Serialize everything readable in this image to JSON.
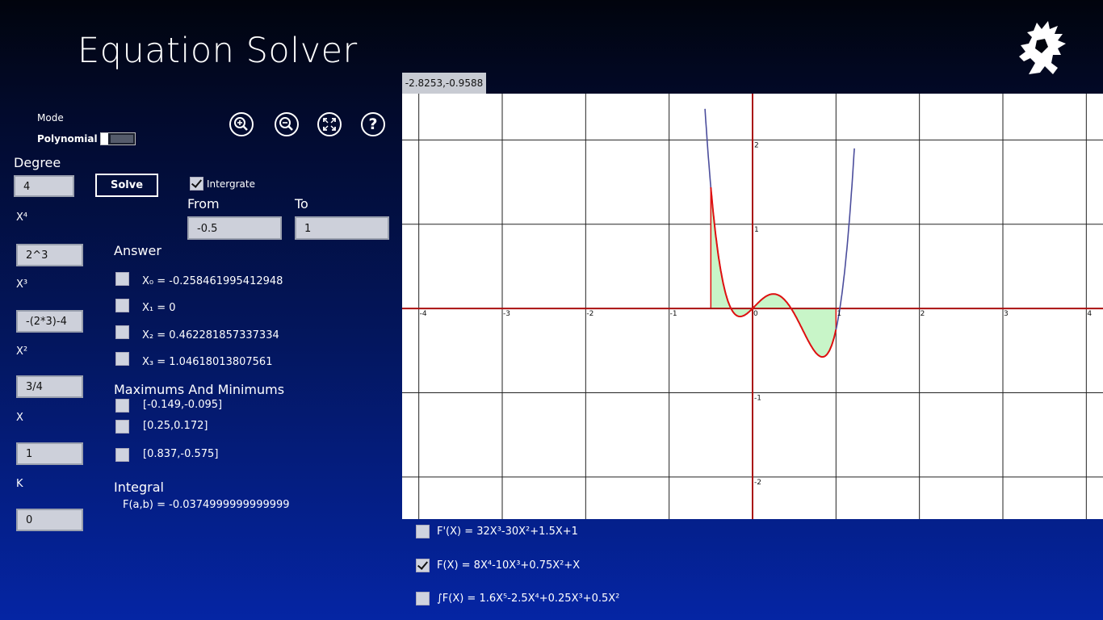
{
  "app": {
    "title": "Equation Solver"
  },
  "mode": {
    "label": "Mode",
    "value": "Polynomial"
  },
  "degree": {
    "label": "Degree",
    "value": "4",
    "solve_label": "Solve"
  },
  "integrate": {
    "label": "Intergrate",
    "checked": true,
    "from_label": "From",
    "from_value": "-0.5",
    "to_label": "To",
    "to_value": "1"
  },
  "coefficients": [
    {
      "label": "X⁴",
      "value": "2^3"
    },
    {
      "label": "X³",
      "value": "-(2*3)-4"
    },
    {
      "label": "X²",
      "value": "3/4"
    },
    {
      "label": "X",
      "value": "1"
    },
    {
      "label": "K",
      "value": "0"
    }
  ],
  "answer": {
    "heading": "Answer",
    "roots": [
      {
        "label": "X₀ = -0.258461995412948",
        "checked": false
      },
      {
        "label": "X₁ = 0",
        "checked": false
      },
      {
        "label": "X₂ = 0.462281857337334",
        "checked": false
      },
      {
        "label": "X₃ = 1.04618013807561",
        "checked": false
      }
    ]
  },
  "extrema": {
    "heading": "Maximums And Minimums",
    "items": [
      {
        "label": "[-0.149,-0.095]",
        "checked": false
      },
      {
        "label": "[0.25,0.172]",
        "checked": false
      },
      {
        "label": "[0.837,-0.575]",
        "checked": false
      }
    ]
  },
  "integral": {
    "heading": "Integral",
    "value": "F(a,b) = -0.0374999999999999"
  },
  "cursor_coords": "-2.8253,-0.9588",
  "functions": [
    {
      "label": "F'(X) = 32X³-30X²+1.5X+1",
      "checked": false
    },
    {
      "label": "F(X) = 8X⁴-10X³+0.75X²+X",
      "checked": true
    },
    {
      "label": "∫F(X) = 1.6X⁵-2.5X⁴+0.25X³+0.5X²",
      "checked": false
    }
  ],
  "toolbar": {
    "zoom_in": "zoom-in-icon",
    "zoom_out": "zoom-out-icon",
    "fit": "fit-screen-icon",
    "help": "help-icon"
  },
  "chart_data": {
    "type": "line",
    "function": "8x^4-10x^3+0.75x^2+x",
    "xlim": [
      -4.2,
      4.2
    ],
    "ylim": [
      -2.5,
      2.55
    ],
    "x_ticks": [
      "-4",
      "-3",
      "-2",
      "-1",
      "0",
      "1",
      "2",
      "3",
      "4"
    ],
    "y_ticks": [
      "2",
      "1",
      "-1",
      "-2"
    ],
    "shaded_interval": [
      -0.5,
      1
    ],
    "grid": true,
    "colors": {
      "curve": "#4b4d9c",
      "highlight": "#e01010",
      "fill": "#c8f5c8",
      "axis": "#aa1010",
      "grid": "#222222"
    }
  }
}
